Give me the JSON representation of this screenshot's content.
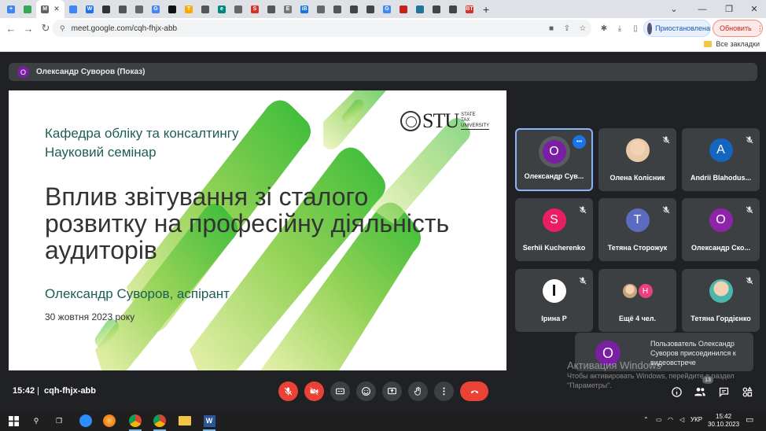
{
  "browser": {
    "tabs": [
      {
        "fav": "+",
        "color": "#4285f4"
      },
      {
        "fav": "",
        "color": "#34a853"
      },
      {
        "fav": "M",
        "color": "#5f6368",
        "active": true
      },
      {
        "fav": "",
        "color": "#4285f4"
      },
      {
        "fav": "W",
        "color": "#1a73e8"
      },
      {
        "fav": "",
        "color": "#333"
      },
      {
        "fav": "",
        "color": "#555"
      },
      {
        "fav": "",
        "color": "#666"
      },
      {
        "fav": "G",
        "color": "#4285f4"
      },
      {
        "fav": "",
        "color": "#111"
      },
      {
        "fav": "T",
        "color": "#f9ab00"
      },
      {
        "fav": "",
        "color": "#555"
      },
      {
        "fav": "e",
        "color": "#00897b"
      },
      {
        "fav": "",
        "color": "#666"
      },
      {
        "fav": "S",
        "color": "#d93025"
      },
      {
        "fav": "",
        "color": "#555"
      },
      {
        "fav": "E",
        "color": "#777"
      },
      {
        "fav": "iB",
        "color": "#1a73e8"
      },
      {
        "fav": "",
        "color": "#666"
      },
      {
        "fav": "",
        "color": "#555"
      },
      {
        "fav": "",
        "color": "#444"
      },
      {
        "fav": "",
        "color": "#444"
      },
      {
        "fav": "G",
        "color": "#4285f4"
      },
      {
        "fav": "",
        "color": "#c5221f"
      },
      {
        "fav": "",
        "color": "#21759b"
      },
      {
        "fav": "",
        "color": "#444"
      },
      {
        "fav": "",
        "color": "#444"
      },
      {
        "fav": "BT",
        "color": "#d93025"
      }
    ],
    "url": "meet.google.com/cqh-fhjx-abb",
    "paused_label": "Приостановлена",
    "update_label": "Обновить",
    "bookmarks_label": "Все закладки"
  },
  "meet": {
    "presenter": {
      "initial": "О",
      "name": "Олександр Суворов (Показ)"
    },
    "slide": {
      "dept_line1": "Кафедра обліку та консалтингу",
      "dept_line2": "Науковий семінар",
      "title": "Вплив звітування зі сталого розвитку на професійну діяльність аудиторів",
      "author": "Олександр Суворов, аспірант",
      "date": "30 жовтня 2023 року",
      "logo_text": "STU",
      "logo_sub1": "STATE",
      "logo_sub2": "TAX",
      "logo_sub3": "UNIVERSITY"
    },
    "participants": [
      {
        "initial": "О",
        "name": "Олександр Сув...",
        "color": "#7b1fa2",
        "speaking": true
      },
      {
        "initial": "",
        "name": "Олена Колісник",
        "color": "#e8c9a8",
        "photo": true
      },
      {
        "initial": "A",
        "name": "Andrii Blahodus...",
        "color": "#1565c0"
      },
      {
        "initial": "S",
        "name": "Serhii Kucherenko",
        "color": "#e91e63"
      },
      {
        "initial": "Т",
        "name": "Тетяна Сторожук",
        "color": "#5c6bc0"
      },
      {
        "initial": "О",
        "name": "Олександр Ско...",
        "color": "#8e24aa"
      },
      {
        "initial": "I",
        "name": "Ірина Р",
        "color": "#ffffff",
        "photo": true
      },
      {
        "initial": "Н",
        "name": "Ещё 4 чел.",
        "color": "#ec407a",
        "group": true
      },
      {
        "initial": "",
        "name": "Тетяна Гордієнко",
        "color": "#4db6ac",
        "photo": true
      }
    ],
    "notification": {
      "initial": "О",
      "text": "Пользователь Олександр Суворов присоединился к видеовстрече"
    },
    "time": "15:42",
    "meeting_code": "cqh-fhjx-abb",
    "participant_count": "13"
  },
  "activation": {
    "title": "Активация Windows",
    "text": "Чтобы активировать Windows, перейдите в раздел \"Параметры\"."
  },
  "taskbar": {
    "lang": "УКР",
    "time": "15:42",
    "date": "30.10.2023"
  }
}
